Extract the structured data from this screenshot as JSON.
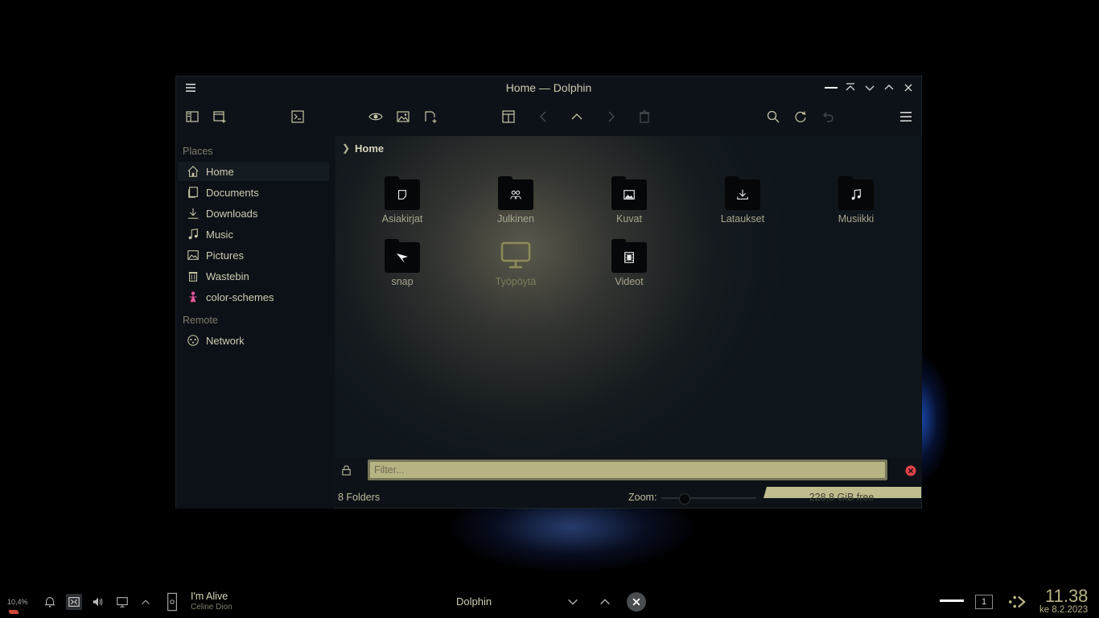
{
  "window": {
    "title": "Home — Dolphin"
  },
  "sidebar": {
    "places_title": "Places",
    "places": [
      {
        "label": "Home",
        "icon": "home-icon"
      },
      {
        "label": "Documents",
        "icon": "documents-icon"
      },
      {
        "label": "Downloads",
        "icon": "downloads-icon"
      },
      {
        "label": "Music",
        "icon": "music-icon"
      },
      {
        "label": "Pictures",
        "icon": "pictures-icon"
      },
      {
        "label": "Wastebin",
        "icon": "trash-icon"
      },
      {
        "label": "color-schemes",
        "icon": "pink-figure-icon"
      }
    ],
    "remote_title": "Remote",
    "remote": [
      {
        "label": "Network",
        "icon": "network-icon"
      }
    ]
  },
  "breadcrumb": {
    "current": "Home"
  },
  "items": [
    {
      "label": "Asiakirjat",
      "icon": "document-folder-icon"
    },
    {
      "label": "Julkinen",
      "icon": "public-folder-icon"
    },
    {
      "label": "Kuvat",
      "icon": "image-folder-icon"
    },
    {
      "label": "Lataukset",
      "icon": "download-folder-icon"
    },
    {
      "label": "Musiikki",
      "icon": "music-folder-icon"
    },
    {
      "label": "snap",
      "icon": "snap-folder-icon"
    },
    {
      "label": "Työpöytä",
      "icon": "desktop-monitor-icon"
    },
    {
      "label": "Videot",
      "icon": "video-folder-icon"
    }
  ],
  "filter": {
    "placeholder": "Filter..."
  },
  "status": {
    "count": "8 Folders",
    "zoom_label": "Zoom:",
    "free_space": "228,8 GiB free",
    "zoom_level": 0.25
  },
  "taskbar": {
    "cpu": "10,4%",
    "media_title": "I'm Alive",
    "media_artist": "Celine Dion",
    "task_label": "Dolphin",
    "desktop_number": "1",
    "time": "11.38",
    "date": "ke 8.2.2023"
  },
  "colors": {
    "accent": "#b7b484",
    "background": "#0c1217",
    "text": "#cfcdb2",
    "close_red": "#e0414b"
  }
}
